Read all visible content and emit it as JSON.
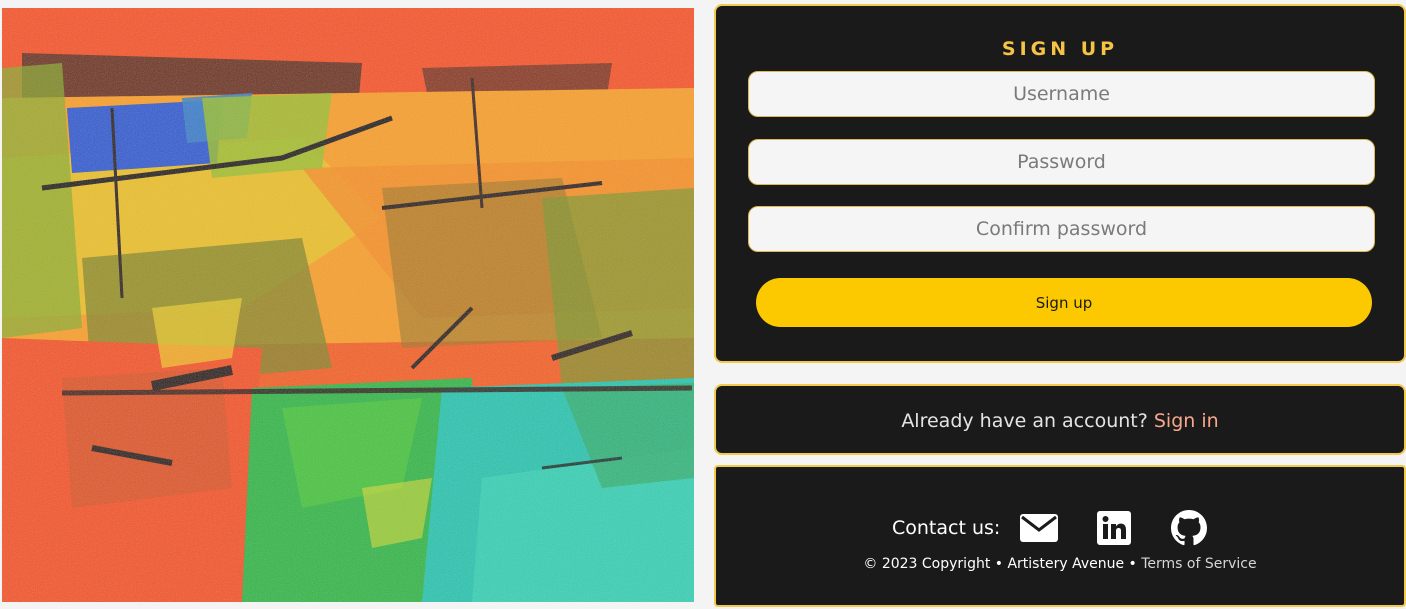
{
  "artwork": {
    "icon": "abstract-painting",
    "colors": [
      "#f26418",
      "#f7a21b",
      "#e8d21e",
      "#8cae23",
      "#2fb84a",
      "#1fc5b1",
      "#2f5fd0",
      "#3a1e10"
    ]
  },
  "signup": {
    "title": "SIGN UP",
    "username_placeholder": "Username",
    "password_placeholder": "Password",
    "confirm_placeholder": "Confirm password",
    "button_label": "Sign up"
  },
  "signin": {
    "prompt": "Already have an account?",
    "link_label": "Sign in"
  },
  "footer": {
    "contact_label": "Contact us:",
    "icons": [
      "envelope-icon",
      "linkedin-icon",
      "github-icon"
    ],
    "copyright": "© 2023 Copyright • Artistery Avenue •",
    "terms_label": "Terms of Service"
  },
  "colors": {
    "panel_bg": "#1b1a1a",
    "panel_border": "#f2c94c",
    "accent": "#fcc800",
    "title": "#f6c344",
    "link": "#f7a88b"
  }
}
